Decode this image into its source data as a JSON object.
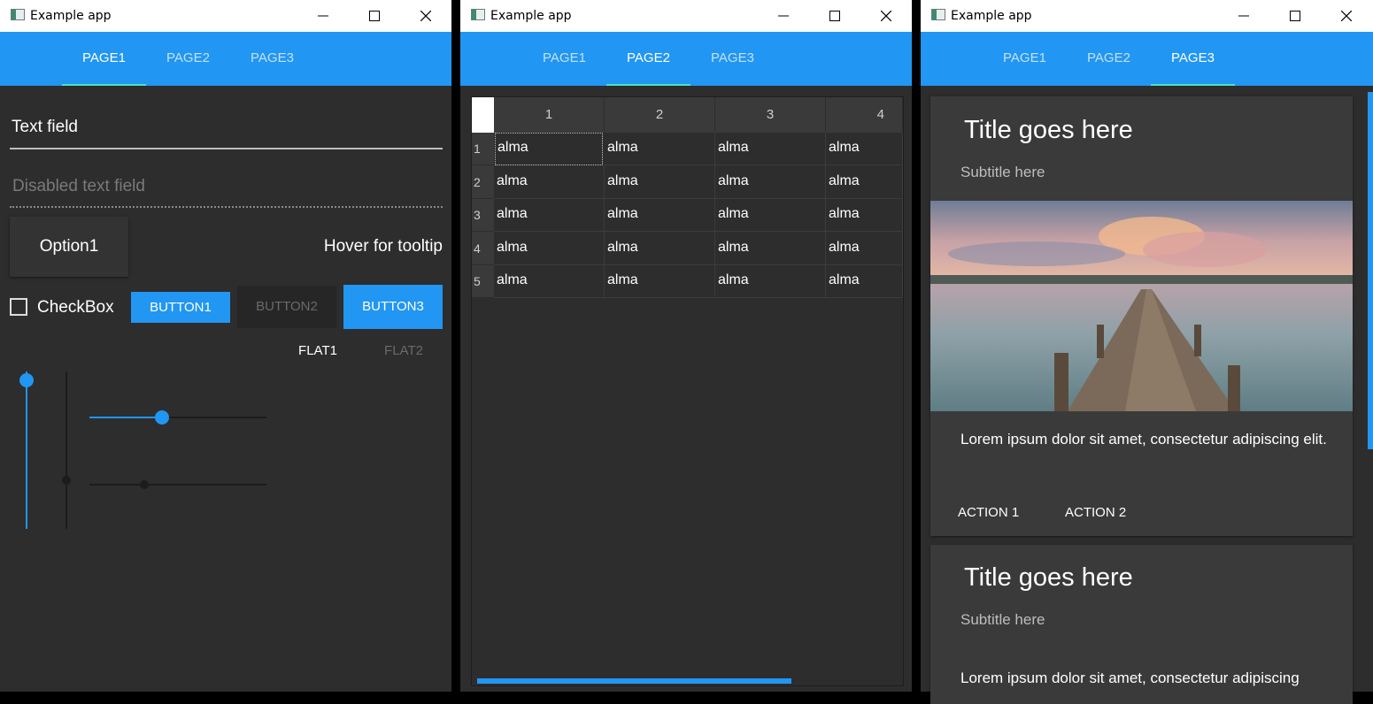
{
  "window_title": "Example app",
  "tabs": [
    "PAGE1",
    "PAGE2",
    "PAGE3"
  ],
  "page1": {
    "text_field_label": "Text field",
    "disabled_field_label": "Disabled text field",
    "option1": "Option1",
    "tooltip_hint": "Hover for tooltip",
    "checkbox_label": "CheckBox",
    "button1": "BUTTON1",
    "button2": "BUTTON2",
    "button3": "BUTTON3",
    "flat1": "FLAT1",
    "flat2": "FLAT2",
    "sliders": {
      "vertical_active": 1.0,
      "horizontal_active": 0.41,
      "horizontal_disabled": 0.31
    }
  },
  "page2": {
    "columns": [
      "1",
      "2",
      "3",
      "4"
    ],
    "rows": [
      {
        "num": "1",
        "cells": [
          "alma",
          "alma",
          "alma",
          "alma"
        ]
      },
      {
        "num": "2",
        "cells": [
          "alma",
          "alma",
          "alma",
          "alma"
        ]
      },
      {
        "num": "3",
        "cells": [
          "alma",
          "alma",
          "alma",
          "alma"
        ]
      },
      {
        "num": "4",
        "cells": [
          "alma",
          "alma",
          "alma",
          "alma"
        ]
      },
      {
        "num": "5",
        "cells": [
          "alma",
          "alma",
          "alma",
          "alma"
        ]
      }
    ]
  },
  "page3": {
    "cards": [
      {
        "title": "Title goes here",
        "subtitle": "Subtitle here",
        "text": "Lorem ipsum dolor sit amet, consectetur adipiscing elit.",
        "action1": "ACTION 1",
        "action2": "ACTION 2"
      },
      {
        "title": "Title goes here",
        "subtitle": "Subtitle here",
        "text": "Lorem ipsum dolor sit amet, consectetur adipiscing"
      }
    ]
  },
  "colors": {
    "accent": "#2196f3",
    "tab_indicator": "#4de3c6",
    "background": "#2d2d2d"
  }
}
